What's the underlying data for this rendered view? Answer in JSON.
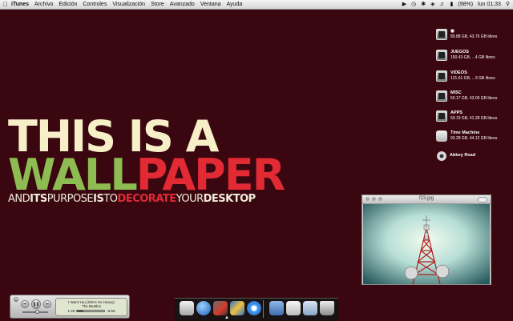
{
  "menubar": {
    "app_name": "iTunes",
    "menus": [
      "Archivo",
      "Edición",
      "Controles",
      "Visualización",
      "Store",
      "Avanzado",
      "Ventana",
      "Ayuda"
    ],
    "battery": "(98%)",
    "clock": "lun 01:33"
  },
  "wallpaper": {
    "line1": "THIS IS A",
    "line2_a": "WALL",
    "line2_b": "PAPER",
    "line3": [
      {
        "text": "AND",
        "style": "l"
      },
      {
        "text": "ITS",
        "style": "b"
      },
      {
        "text": "PURPOSE",
        "style": "l"
      },
      {
        "text": "IS",
        "style": "b"
      },
      {
        "text": "TO",
        "style": "l"
      },
      {
        "text": "DECORATE",
        "style": "r"
      },
      {
        "text": "YOUR",
        "style": "l"
      },
      {
        "text": "DESKTOP",
        "style": "b"
      }
    ]
  },
  "drives": [
    {
      "name": "",
      "info": "80.88 GB, 43.76 GB libres",
      "icon": "hard-drive-icon"
    },
    {
      "name": "JUEGOS",
      "info": "150.43 GB, ...4 GB libres",
      "icon": "hard-drive-icon"
    },
    {
      "name": "VIDEOS",
      "info": "121.61 GB, ...3 GB libres",
      "icon": "hard-drive-icon"
    },
    {
      "name": "MISC",
      "info": "50.17 GB, 43.09 GB libres",
      "icon": "hard-drive-icon"
    },
    {
      "name": "APPS",
      "info": "50.19 GB, 41.28 GB libres",
      "icon": "hard-drive-icon"
    },
    {
      "name": "Time Machine",
      "info": "93.28 GB, 44.12 GB libres",
      "icon": "time-machine-drive-icon"
    },
    {
      "name": "Abbey Road",
      "info": "",
      "icon": "cd-icon"
    }
  ],
  "preview": {
    "title": "f23.jpg"
  },
  "itunes": {
    "song": "I Want You (She's So Heavy)",
    "artist": "The Beatles",
    "elapsed": "1:48",
    "remaining": "-5:59",
    "progress": 0.23,
    "volume": 0.55
  },
  "dock": {
    "items": [
      "finder-icon",
      "network-icon",
      "app-icon",
      "photo-app-icon",
      "safari-icon",
      "applications-folder-icon",
      "documents-folder-icon",
      "mail-stack-icon",
      "trash-icon"
    ]
  },
  "colors": {
    "background": "#3a0710",
    "cream": "#f6efc8",
    "green": "#8dbd52",
    "red": "#e12a33"
  }
}
